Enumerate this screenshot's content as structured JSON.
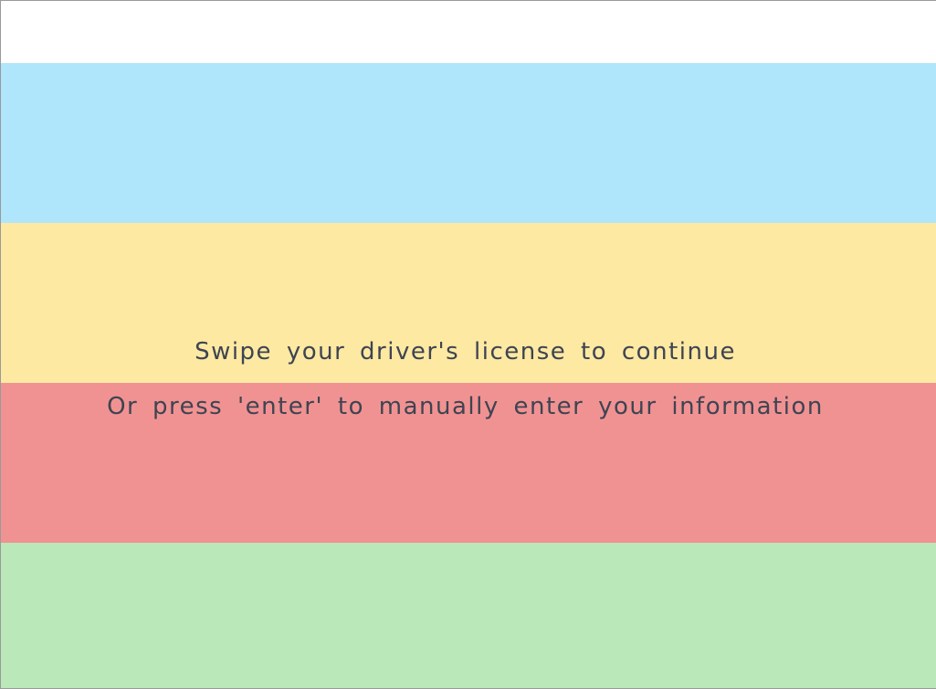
{
  "messages": {
    "swipe": "Swipe your driver's license to continue",
    "manual": "Or press 'enter' to manually enter your information"
  },
  "colors": {
    "top": "#ffffff",
    "blue": "#b0e6fc",
    "yellow": "#fee9a2",
    "red": "#f19292",
    "green": "#bae8b9",
    "text": "#3e4452"
  }
}
